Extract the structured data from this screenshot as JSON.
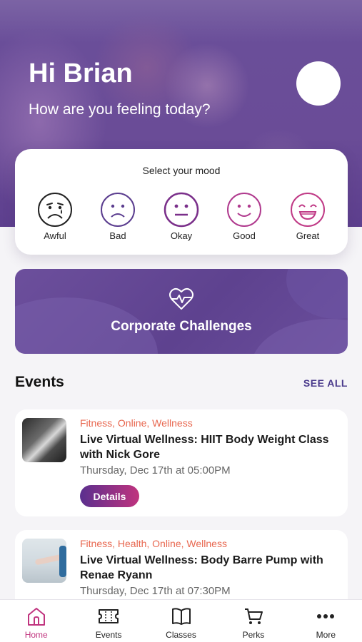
{
  "header": {
    "greeting": "Hi Brian",
    "subtitle": "How are you feeling today?"
  },
  "mood": {
    "title": "Select your mood",
    "options": [
      {
        "label": "Awful",
        "icon": "awful-face-icon",
        "color": "#222222"
      },
      {
        "label": "Bad",
        "icon": "sad-face-icon",
        "color": "#5b3d8f"
      },
      {
        "label": "Okay",
        "icon": "neutral-face-icon",
        "color": "#7a2f8a"
      },
      {
        "label": "Good",
        "icon": "smile-face-icon",
        "color": "#b03a8e"
      },
      {
        "label": "Great",
        "icon": "laughing-face-icon",
        "color": "#c03a86"
      }
    ]
  },
  "challenges": {
    "label": "Corporate Challenges",
    "icon": "heart-pulse-icon"
  },
  "events": {
    "title": "Events",
    "see_all": "SEE ALL",
    "items": [
      {
        "tags": "Fitness, Online, Wellness",
        "title": "Live Virtual Wellness: HIIT Body Weight Class with Nick Gore",
        "date": "Thursday, Dec 17th at 05:00PM",
        "button": "Details"
      },
      {
        "tags": "Fitness, Health, Online, Wellness",
        "title": "Live Virtual Wellness: Body Barre Pump with Renae Ryann",
        "date": "Thursday, Dec 17th at 07:30PM"
      }
    ]
  },
  "nav": {
    "items": [
      {
        "label": "Home",
        "icon": "home-icon",
        "active": true
      },
      {
        "label": "Events",
        "icon": "ticket-icon"
      },
      {
        "label": "Classes",
        "icon": "book-icon"
      },
      {
        "label": "Perks",
        "icon": "cart-icon"
      },
      {
        "label": "More",
        "icon": "more-dots-icon"
      }
    ]
  },
  "colors": {
    "brand_purple": "#5e428f",
    "accent_magenta": "#c0337e",
    "tag_orange": "#e8674f",
    "link_purple": "#4a3a8c"
  }
}
